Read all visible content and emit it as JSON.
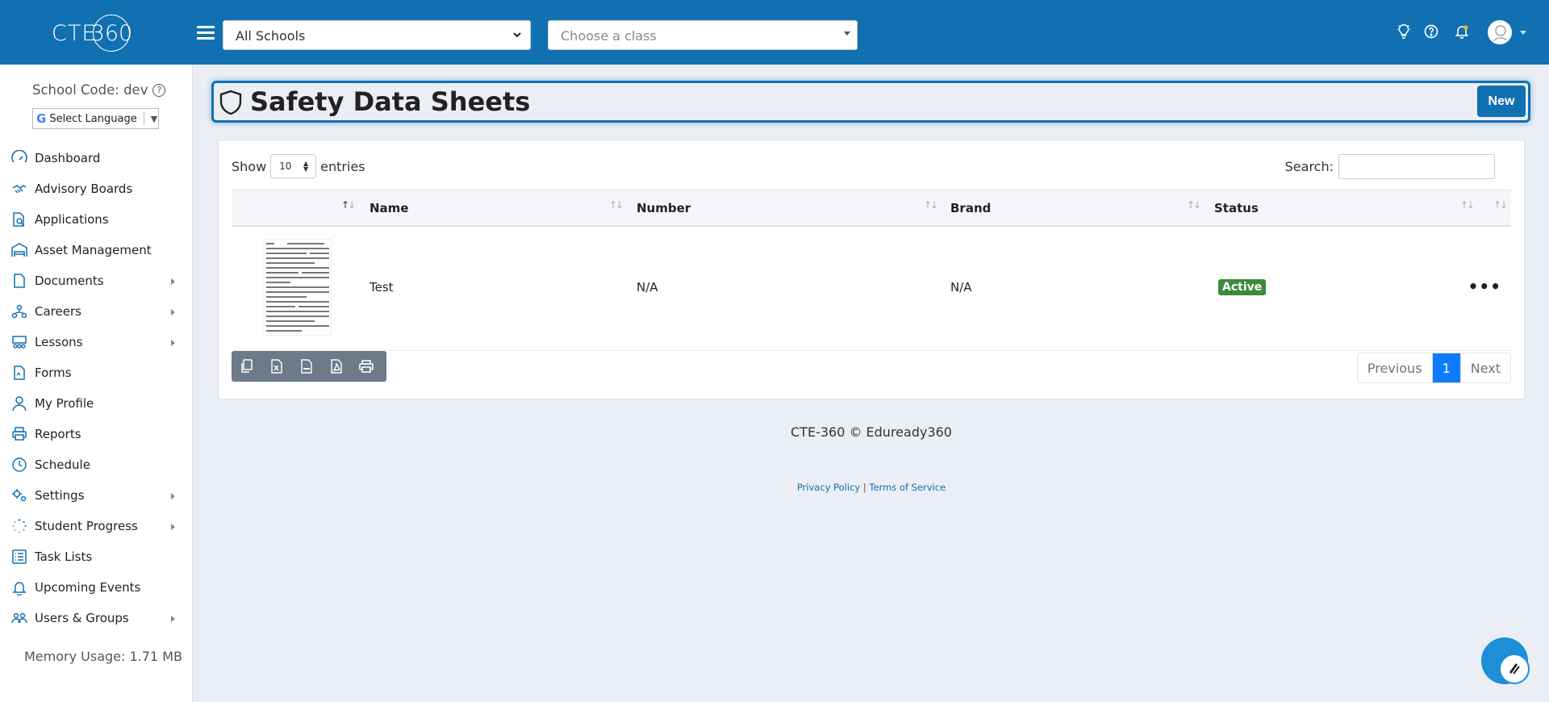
{
  "app": {
    "logo_text": "CTE",
    "logo_num": "360"
  },
  "topbar": {
    "school_select": "All Schools",
    "class_select_placeholder": "Choose a class"
  },
  "sidebar": {
    "school_code": "School Code: dev",
    "language": "Select Language",
    "items": [
      {
        "label": "Dashboard",
        "icon": "gauge-icon",
        "has_children": false
      },
      {
        "label": "Advisory Boards",
        "icon": "handshake-icon",
        "has_children": false
      },
      {
        "label": "Applications",
        "icon": "file-search-icon",
        "has_children": false
      },
      {
        "label": "Asset Management",
        "icon": "warehouse-icon",
        "has_children": false
      },
      {
        "label": "Documents",
        "icon": "document-icon",
        "has_children": true
      },
      {
        "label": "Careers",
        "icon": "people-tree-icon",
        "has_children": true
      },
      {
        "label": "Lessons",
        "icon": "classroom-icon",
        "has_children": true
      },
      {
        "label": "Forms",
        "icon": "form-icon",
        "has_children": false
      },
      {
        "label": "My Profile",
        "icon": "user-icon",
        "has_children": false
      },
      {
        "label": "Reports",
        "icon": "printer-icon",
        "has_children": false
      },
      {
        "label": "Schedule",
        "icon": "clock-icon",
        "has_children": false
      },
      {
        "label": "Settings",
        "icon": "gears-icon",
        "has_children": true
      },
      {
        "label": "Student Progress",
        "icon": "spinner-icon",
        "has_children": true
      },
      {
        "label": "Task Lists",
        "icon": "list-icon",
        "has_children": false
      },
      {
        "label": "Upcoming Events",
        "icon": "bell-icon",
        "has_children": false
      },
      {
        "label": "Users & Groups",
        "icon": "users-icon",
        "has_children": true
      }
    ],
    "memory": "Memory Usage: 1.71 MB"
  },
  "page": {
    "title": "Safety Data Sheets",
    "new_label": "New"
  },
  "table_controls": {
    "show_label": "Show",
    "entries_value": "10",
    "entries_label": "entries",
    "search_label": "Search:"
  },
  "table": {
    "columns": [
      "Name",
      "Number",
      "Brand",
      "Status"
    ],
    "rows": [
      {
        "name": "Test",
        "number": "N/A",
        "brand": "N/A",
        "status": "Active"
      }
    ]
  },
  "pagination": {
    "previous": "Previous",
    "current": "1",
    "next": "Next"
  },
  "footer": {
    "copyright": "CTE-360 © Eduready360",
    "privacy": "Privacy Policy",
    "separator": "|",
    "terms": "Terms of Service"
  },
  "colors": {
    "brand": "#1170b1",
    "active_badge": "#3c8b3c",
    "page_current": "#0d7bff"
  }
}
